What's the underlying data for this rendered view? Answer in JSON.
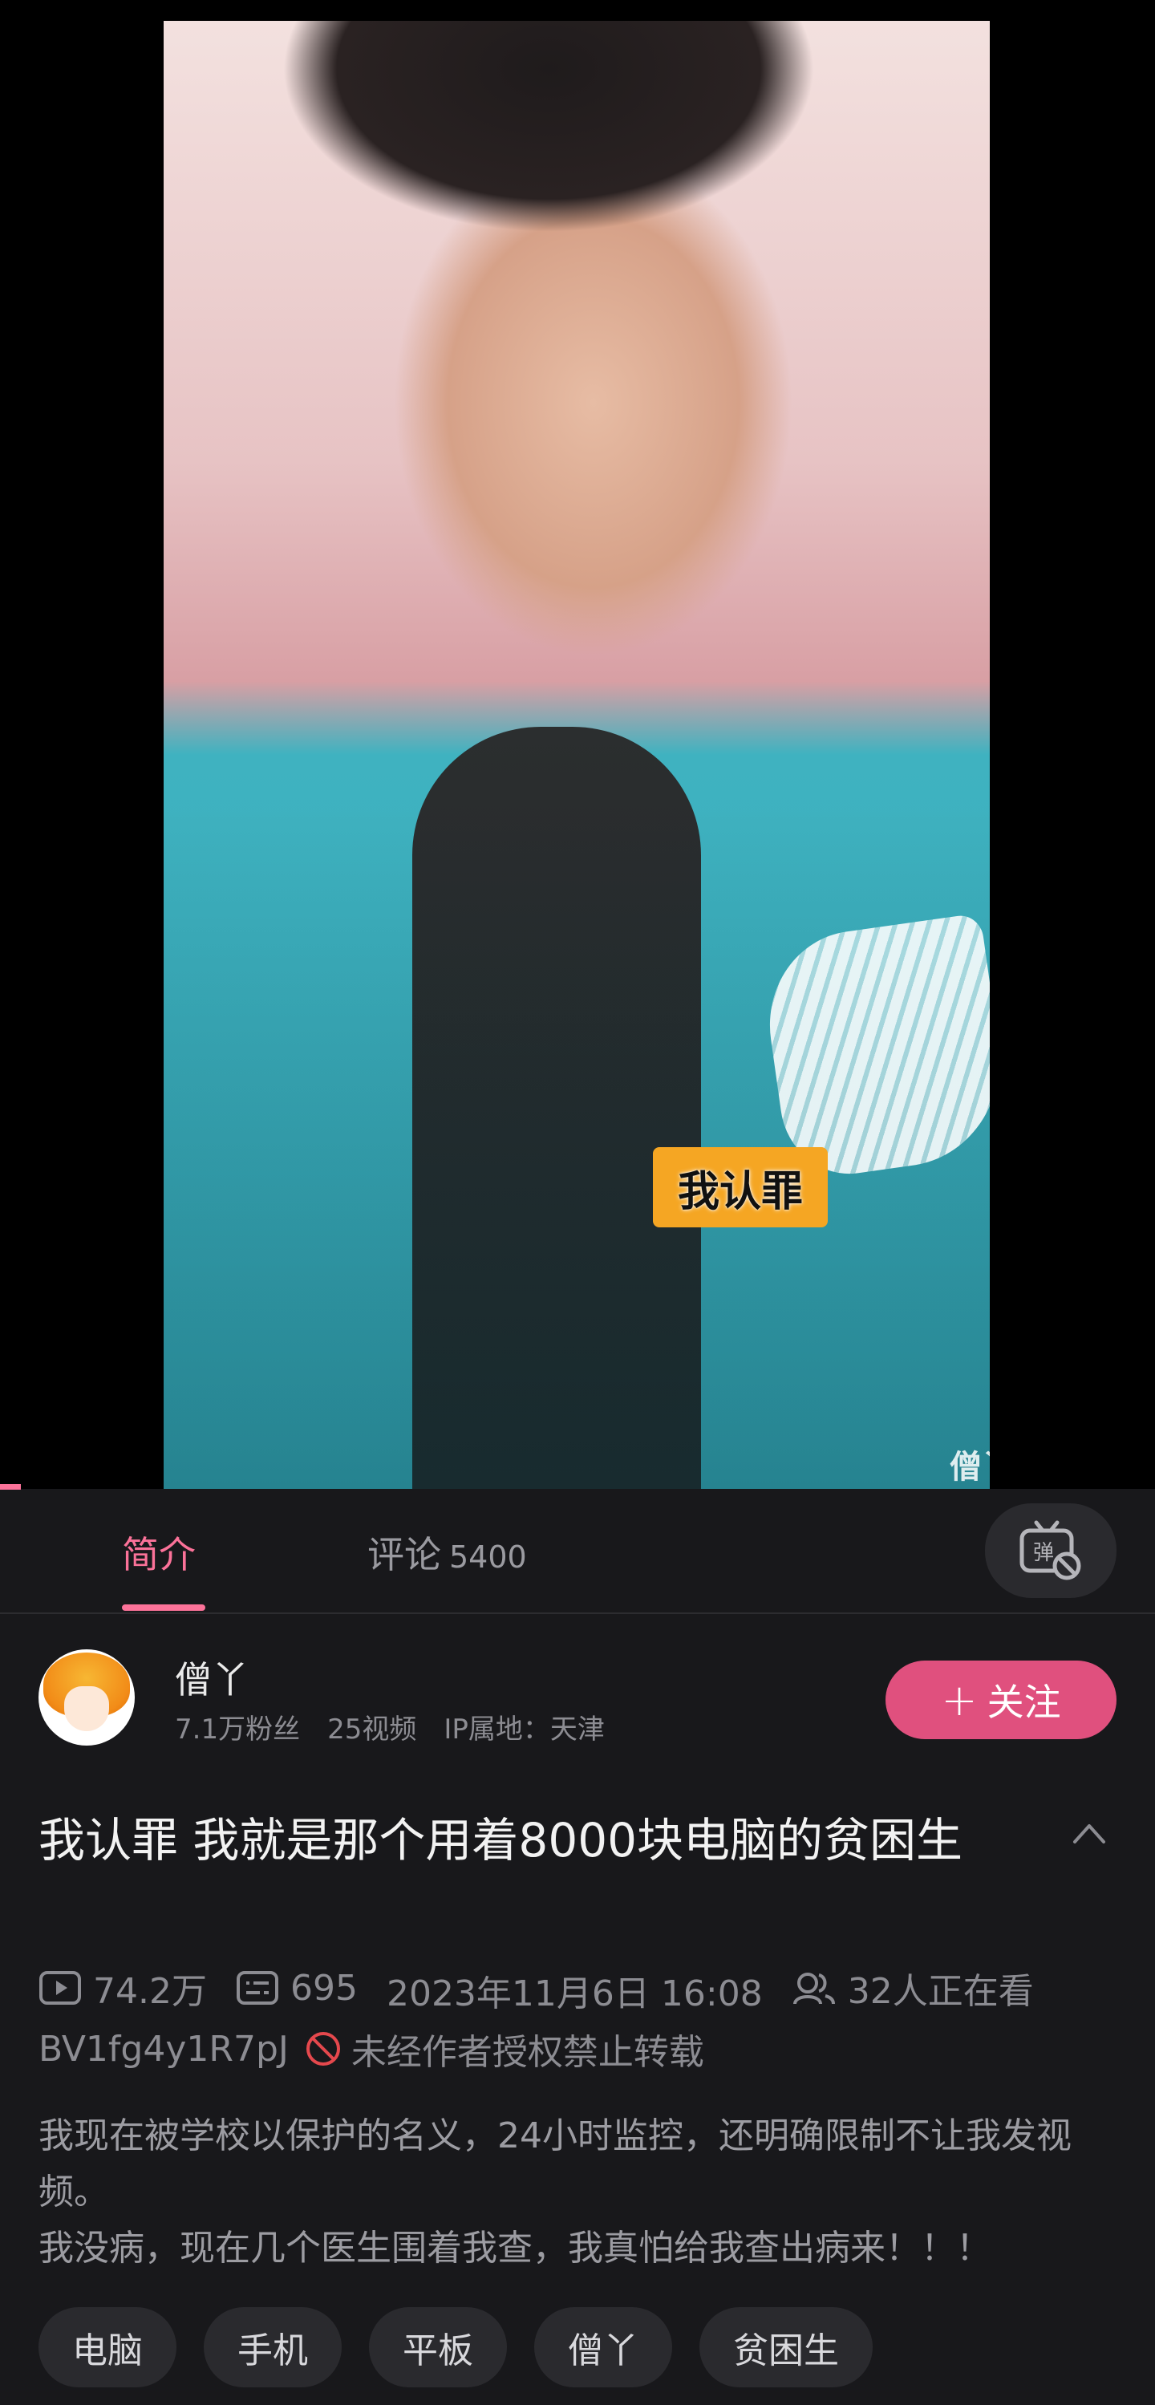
{
  "video": {
    "subtitle": "我认罪",
    "watermark": "僧丫 bilibili"
  },
  "tabs": {
    "intro": "简介",
    "comments": "评论",
    "comments_count": "5400"
  },
  "uploader": {
    "name": "僧丫",
    "followers": "7.1万粉丝",
    "videos": "25视频",
    "ip_location": "IP属地：天津",
    "follow_label": "关注"
  },
  "title": "我认罪 我就是那个用着8000块电脑的贫困生",
  "meta": {
    "views": "74.2万",
    "danmaku_count": "695",
    "date": "2023年11月6日 16:08",
    "watching": "32人正在看",
    "bvid": "BV1fg4y1R7pJ",
    "repost_notice": "未经作者授权禁止转载"
  },
  "description": [
    "我现在被学校以保护的名义，24小时监控，还明确限制不让我发视频。",
    "我没病，现在几个医生围着我查，我真怕给我查出病来！！！"
  ],
  "tags": [
    "电脑",
    "手机",
    "平板",
    "僧丫",
    "贫困生"
  ],
  "colors": {
    "accent": "#fb7299",
    "follow_button": "#e0507e",
    "background": "#18181b"
  }
}
